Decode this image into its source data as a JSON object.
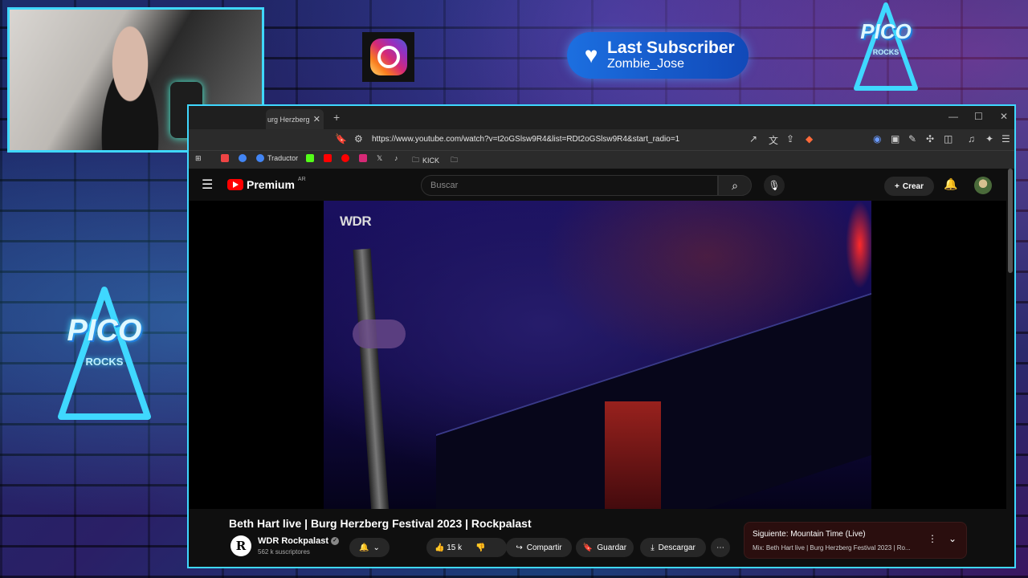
{
  "overlay": {
    "last_subscriber_label": "Last Subscriber",
    "last_subscriber_name": "Zombie_Jose",
    "logo_word": "PICO",
    "logo_sub": "ROCKS"
  },
  "browser": {
    "tab_title": "urg Herzberg",
    "url": "https://www.youtube.com/watch?v=t2oGSlsw9R4&list=RDt2oGSlsw9R4&start_radio=1",
    "bookmarks": [
      "Traductor",
      "KICK"
    ]
  },
  "youtube": {
    "brand": "Premium",
    "region": "AR",
    "search_placeholder": "Buscar",
    "create_label": "Crear",
    "video_watermark": "WDR",
    "video_title": "Beth Hart live | Burg Herzberg Festival 2023 | Rockpalast",
    "channel_name": "WDR Rockpalast",
    "channel_subs": "562 k suscriptores",
    "likes": "15 k",
    "share_label": "Compartir",
    "save_label": "Guardar",
    "download_label": "Descargar",
    "next_title": "Siguiente: Mountain Time (Live)",
    "next_sub": "Mix: Beth Hart live | Burg Herzberg Festival 2023 | Ro..."
  },
  "colors": {
    "frame_border": "#3fd8ff",
    "youtube_red": "#ff0000",
    "subscriber_pill": "#1c6fe0"
  }
}
